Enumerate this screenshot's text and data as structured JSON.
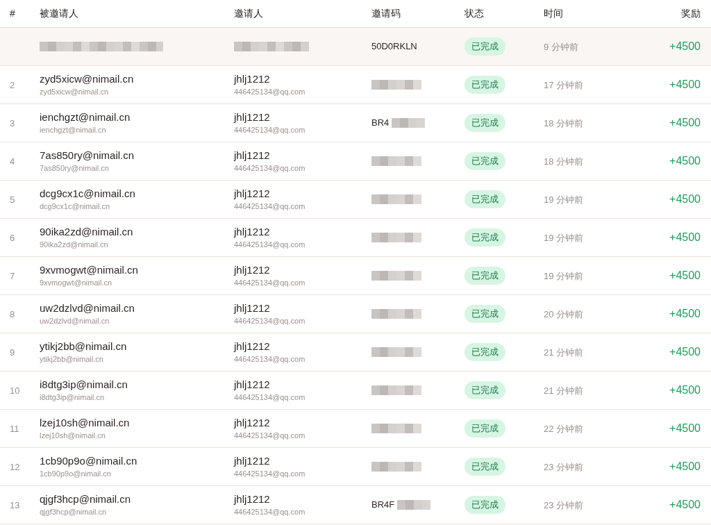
{
  "table": {
    "columns": [
      "#",
      "被邀请人",
      "邀请人",
      "邀请码",
      "状态",
      "时间",
      "奖励"
    ],
    "rows": [
      {
        "highlighted": true,
        "invitee": {
          "redacted": true
        },
        "inviter": {
          "redacted": true
        },
        "code": {
          "text": "50D0RKLN",
          "redacted": false
        },
        "status": "已完成",
        "time": "9 分钟前",
        "reward": "+4500"
      },
      {
        "highlighted": false,
        "index": "2",
        "invitee": {
          "name": "zyd5xicw@nimail.cn",
          "email": "zyd5xicw@nimail.cn",
          "redacted": false
        },
        "inviter": {
          "name": "jhlj1212",
          "email": "446425134@qq.com",
          "redacted": false
        },
        "code": {
          "redacted": true
        },
        "status": "已完成",
        "time": "17 分钟前",
        "reward": "+4500"
      },
      {
        "highlighted": false,
        "index": "3",
        "invitee": {
          "name": "ienchgzt@nimail.cn",
          "email": "ienchgzt@nimail.cn",
          "redacted": false
        },
        "inviter": {
          "name": "jhlj1212",
          "email": "446425134@qq.com",
          "redacted": false
        },
        "code": {
          "text": "BR4",
          "redacted": true
        },
        "status": "已完成",
        "time": "18 分钟前",
        "reward": "+4500"
      },
      {
        "highlighted": false,
        "index": "4",
        "invitee": {
          "name": "7as850ry@nimail.cn",
          "email": "7as850ry@nimail.cn",
          "redacted": false
        },
        "inviter": {
          "name": "jhlj1212",
          "email": "446425134@qq.com",
          "redacted": false
        },
        "code": {
          "redacted": true
        },
        "status": "已完成",
        "time": "18 分钟前",
        "reward": "+4500"
      },
      {
        "highlighted": false,
        "index": "5",
        "invitee": {
          "name": "dcg9cx1c@nimail.cn",
          "email": "dcg9cx1c@nimail.cn",
          "redacted": false
        },
        "inviter": {
          "name": "jhlj1212",
          "email": "446425134@qq.com",
          "redacted": false
        },
        "code": {
          "redacted": true
        },
        "status": "已完成",
        "time": "19 分钟前",
        "reward": "+4500"
      },
      {
        "highlighted": false,
        "index": "6",
        "invitee": {
          "name": "90ika2zd@nimail.cn",
          "email": "90ika2zd@nimail.cn",
          "redacted": false
        },
        "inviter": {
          "name": "jhlj1212",
          "email": "446425134@qq.com",
          "redacted": false
        },
        "code": {
          "redacted": true
        },
        "status": "已完成",
        "time": "19 分钟前",
        "reward": "+4500"
      },
      {
        "highlighted": false,
        "index": "7",
        "invitee": {
          "name": "9xvmogwt@nimail.cn",
          "email": "9xvmogwt@nimail.cn",
          "redacted": false
        },
        "inviter": {
          "name": "jhlj1212",
          "email": "446425134@qq.com",
          "redacted": false
        },
        "code": {
          "redacted": true
        },
        "status": "已完成",
        "time": "19 分钟前",
        "reward": "+4500"
      },
      {
        "highlighted": false,
        "index": "8",
        "invitee": {
          "name": "uw2dzlvd@nimail.cn",
          "email": "uw2dzlvd@nimail.cn",
          "redacted": false
        },
        "inviter": {
          "name": "jhlj1212",
          "email": "446425134@qq.com",
          "redacted": false
        },
        "code": {
          "redacted": true
        },
        "status": "已完成",
        "time": "20 分钟前",
        "reward": "+4500"
      },
      {
        "highlighted": false,
        "index": "9",
        "invitee": {
          "name": "ytikj2bb@nimail.cn",
          "email": "ytikj2bb@nimail.cn",
          "redacted": false
        },
        "inviter": {
          "name": "jhlj1212",
          "email": "446425134@qq.com",
          "redacted": false
        },
        "code": {
          "redacted": true
        },
        "status": "已完成",
        "time": "21 分钟前",
        "reward": "+4500"
      },
      {
        "highlighted": false,
        "index": "10",
        "invitee": {
          "name": "i8dtg3ip@nimail.cn",
          "email": "i8dtg3ip@nimail.cn",
          "redacted": false
        },
        "inviter": {
          "name": "jhlj1212",
          "email": "446425134@qq.com",
          "redacted": false
        },
        "code": {
          "redacted": true
        },
        "status": "已完成",
        "time": "21 分钟前",
        "reward": "+4500"
      },
      {
        "highlighted": false,
        "index": "11",
        "invitee": {
          "name": "lzej10sh@nimail.cn",
          "email": "lzej10sh@nimail.cn",
          "redacted": false
        },
        "inviter": {
          "name": "jhlj1212",
          "email": "446425134@qq.com",
          "redacted": false
        },
        "code": {
          "redacted": true
        },
        "status": "已完成",
        "time": "22 分钟前",
        "reward": "+4500"
      },
      {
        "highlighted": false,
        "index": "12",
        "invitee": {
          "name": "1cb90p9o@nimail.cn",
          "email": "1cb90p9o@nimail.cn",
          "redacted": false
        },
        "inviter": {
          "name": "jhlj1212",
          "email": "446425134@qq.com",
          "redacted": false
        },
        "code": {
          "redacted": true
        },
        "status": "已完成",
        "time": "23 分钟前",
        "reward": "+4500"
      },
      {
        "highlighted": false,
        "index": "13",
        "invitee": {
          "name": "qjgf3hcp@nimail.cn",
          "email": "qjgf3hcp@nimail.cn",
          "redacted": false
        },
        "inviter": {
          "name": "jhlj1212",
          "email": "446425134@qq.com",
          "redacted": false
        },
        "code": {
          "text": "BR4F",
          "redacted": true
        },
        "status": "已完成",
        "time": "23 分钟前",
        "reward": "+4500"
      }
    ]
  }
}
